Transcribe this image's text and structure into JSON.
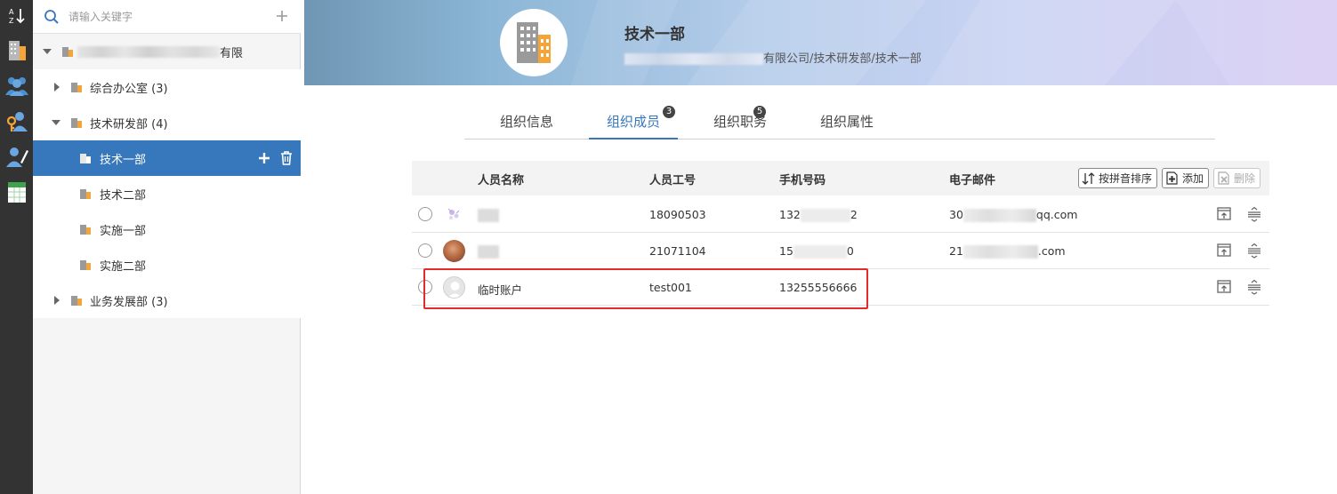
{
  "search": {
    "placeholder": "请输入关键字"
  },
  "tree": {
    "root_suffix": "有限",
    "nodes": [
      {
        "label": "综合办公室 (3)"
      },
      {
        "label": "技术研发部 (4)"
      },
      {
        "label": "技术一部"
      },
      {
        "label": "技术二部"
      },
      {
        "label": "实施一部"
      },
      {
        "label": "实施二部"
      },
      {
        "label": "业务发展部 (3)"
      }
    ]
  },
  "banner": {
    "title": "技术一部",
    "path_suffix": "有限公司/技术研发部/技术一部"
  },
  "tabs": [
    {
      "label": "组织信息"
    },
    {
      "label": "组织成员",
      "badge": "3"
    },
    {
      "label": "组织职务",
      "badge": "5"
    },
    {
      "label": "组织属性"
    }
  ],
  "table": {
    "headers": {
      "name": "人员名称",
      "id": "人员工号",
      "phone": "手机号码",
      "email": "电子邮件"
    },
    "toolbar": {
      "sort": "按拼音排序",
      "add": "添加",
      "delete": "删除"
    },
    "rows": [
      {
        "name": "",
        "id": "18090503",
        "phone_prefix": "132",
        "phone_suffix": "2",
        "email_prefix": "30",
        "email_suffix": "qq.com"
      },
      {
        "name": "",
        "id": "21071104",
        "phone_prefix": "15",
        "phone_suffix": "0",
        "email_prefix": "21",
        "email_suffix": ".com"
      },
      {
        "name": "临时账户",
        "id": "test001",
        "phone": "13255556666",
        "email": ""
      }
    ]
  },
  "colors": {
    "accent": "#3777bc",
    "rail": "#333333",
    "highlight": "#e42a2a"
  }
}
